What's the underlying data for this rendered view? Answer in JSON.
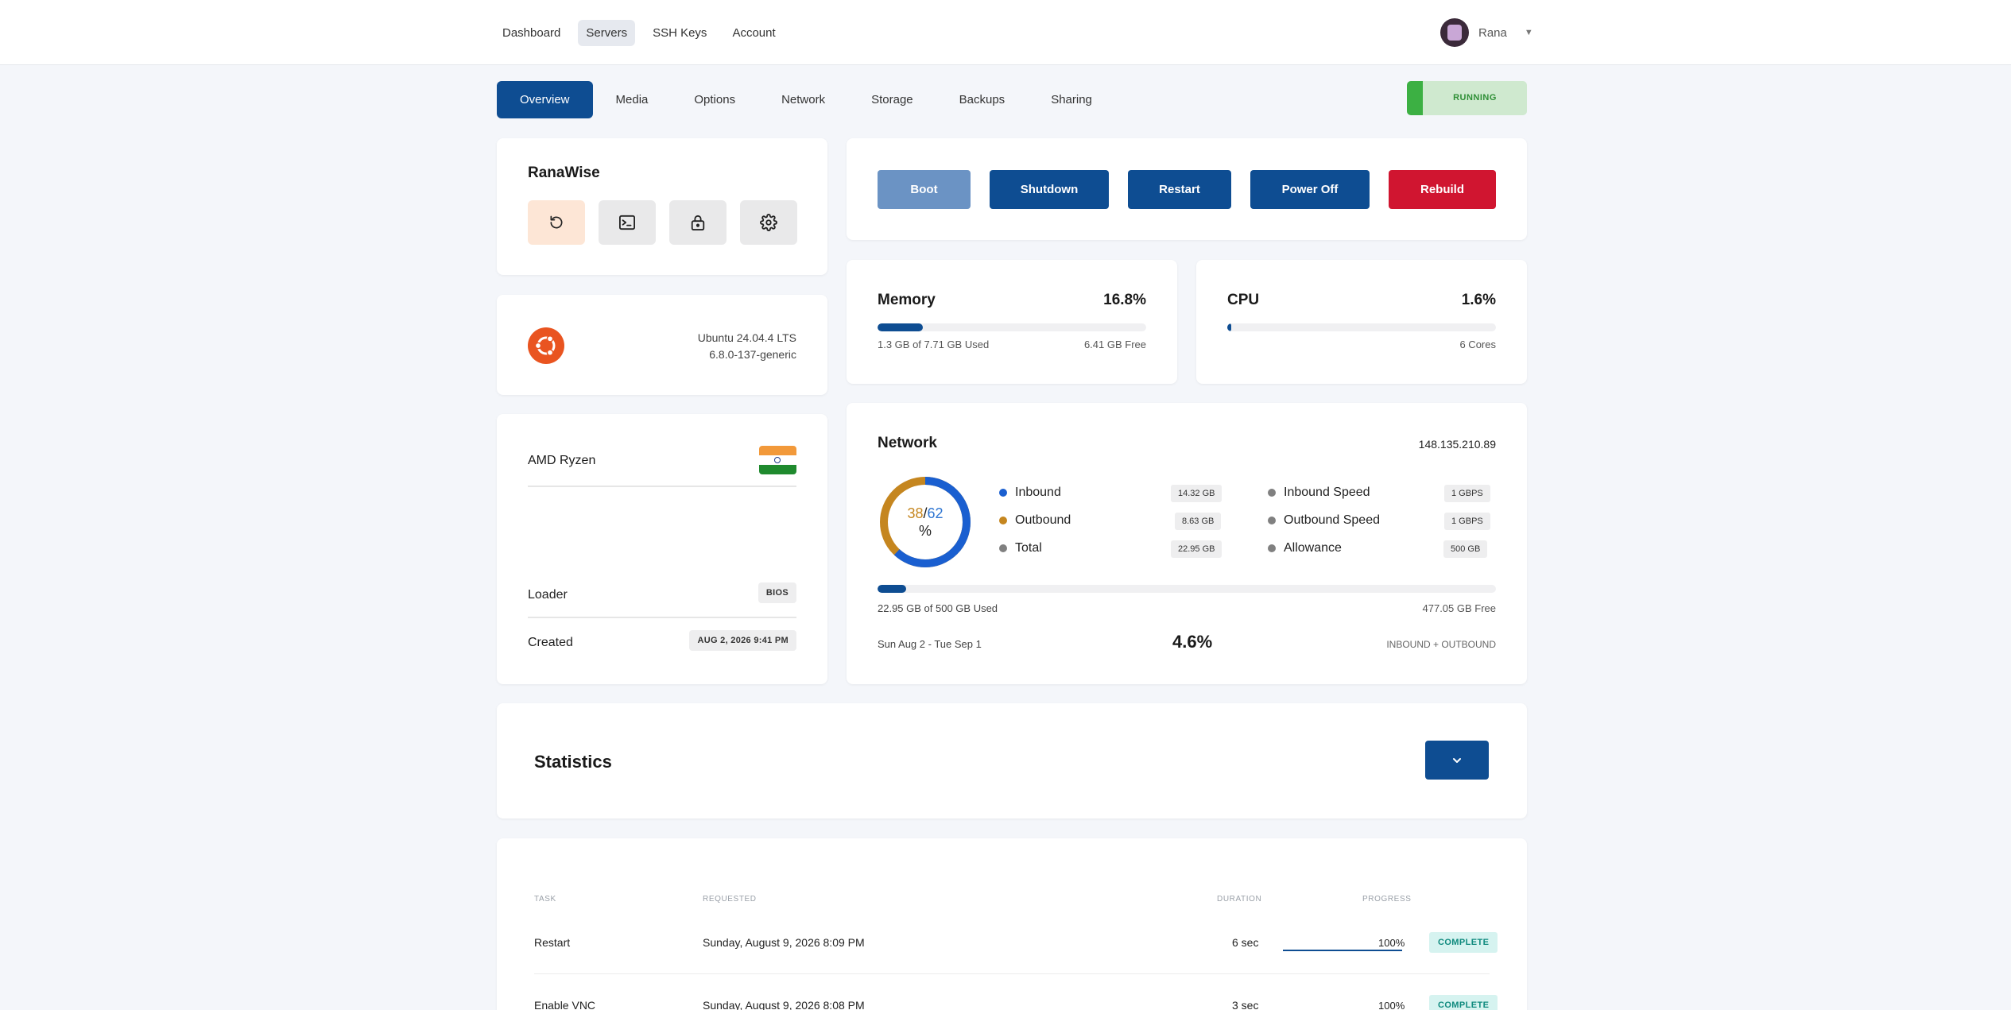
{
  "header": {
    "nav": [
      {
        "label": "Dashboard"
      },
      {
        "label": "Servers"
      },
      {
        "label": "SSH Keys"
      },
      {
        "label": "Account"
      }
    ],
    "user_name": "Rana"
  },
  "tabs": [
    {
      "label": "Overview"
    },
    {
      "label": "Media"
    },
    {
      "label": "Options"
    },
    {
      "label": "Network"
    },
    {
      "label": "Storage"
    },
    {
      "label": "Backups"
    },
    {
      "label": "Sharing"
    }
  ],
  "status": {
    "label": "RUNNING",
    "color": "#3cb043"
  },
  "server": {
    "name": "RanaWise"
  },
  "os": {
    "name": "Ubuntu 24.04.4 LTS",
    "kernel": "6.8.0-137-generic"
  },
  "hardware": {
    "cpu_model": "AMD Ryzen",
    "loader_label": "Loader",
    "loader_value": "BIOS",
    "created_label": "Created",
    "created_value": "AUG 2, 2026 9:41 PM"
  },
  "actions": {
    "boot": "Boot",
    "shutdown": "Shutdown",
    "restart": "Restart",
    "power_off": "Power Off",
    "rebuild": "Rebuild"
  },
  "memory": {
    "title": "Memory",
    "percent_label": "16.8%",
    "percent": 16.8,
    "used": "1.3 GB of 7.71 GB Used",
    "free": "6.41 GB Free"
  },
  "cpu": {
    "title": "CPU",
    "percent_label": "1.6%",
    "percent": 1.6,
    "cores": "6 Cores"
  },
  "network": {
    "title": "Network",
    "ip": "148.135.210.89",
    "donut": {
      "outbound": "38",
      "sep": "/",
      "inbound": "62",
      "unit": "%"
    },
    "legend": [
      {
        "label": "Inbound",
        "value": "14.32 GB",
        "color": "#1a5fd0"
      },
      {
        "label": "Outbound",
        "value": "8.63 GB",
        "color": "#c5861f"
      },
      {
        "label": "Total",
        "value": "22.95 GB",
        "color": "#808080"
      }
    ],
    "limits": [
      {
        "label": "Inbound Speed",
        "value": "1 GBPS"
      },
      {
        "label": "Outbound Speed",
        "value": "1 GBPS"
      },
      {
        "label": "Allowance",
        "value": "500 GB"
      }
    ],
    "usage_fraction": 0.046,
    "used": "22.95 GB of 500 GB Used",
    "free": "477.05 GB Free",
    "period": "Sun Aug 2 - Tue Sep 1",
    "percent_label": "4.6%",
    "basis": "INBOUND + OUTBOUND"
  },
  "statistics": {
    "title": "Statistics"
  },
  "tasks": {
    "headers": {
      "task": "TASK",
      "requested": "REQUESTED",
      "duration": "DURATION",
      "progress": "PROGRESS"
    },
    "rows": [
      {
        "task": "Restart",
        "requested": "Sunday, August 9, 2026 8:09 PM",
        "duration": "6 sec",
        "progress": "100%",
        "status": "COMPLETE"
      },
      {
        "task": "Enable VNC",
        "requested": "Sunday, August 9, 2026 8:08 PM",
        "duration": "3 sec",
        "progress": "100%",
        "status": "COMPLETE"
      }
    ]
  }
}
